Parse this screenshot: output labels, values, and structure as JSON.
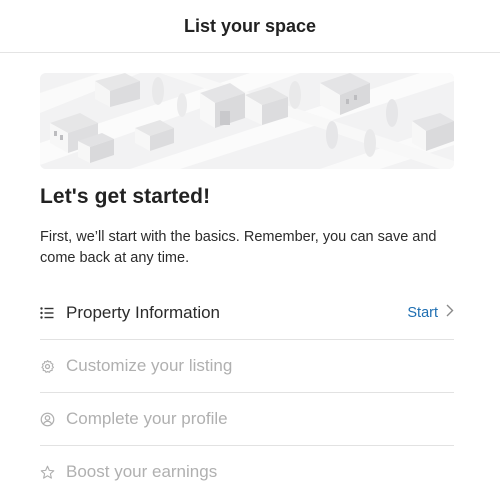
{
  "header": {
    "title": "List your space"
  },
  "main": {
    "heading": "Let's get started!",
    "intro": "First, we’ll start with the basics. Remember, you can save and come back at any time.",
    "steps": [
      {
        "label": "Property Information",
        "icon": "list-icon",
        "action": "Start",
        "status": "active"
      },
      {
        "label": "Customize your listing",
        "icon": "gear-icon",
        "status": "disabled"
      },
      {
        "label": "Complete your profile",
        "icon": "user-circle-icon",
        "status": "disabled"
      },
      {
        "label": "Boost your earnings",
        "icon": "star-icon",
        "status": "disabled"
      }
    ]
  },
  "colors": {
    "link": "#1f6fb2",
    "active_text": "#2b2b2b",
    "disabled_text": "#b0b0b0",
    "divider": "#e2e2e2"
  }
}
